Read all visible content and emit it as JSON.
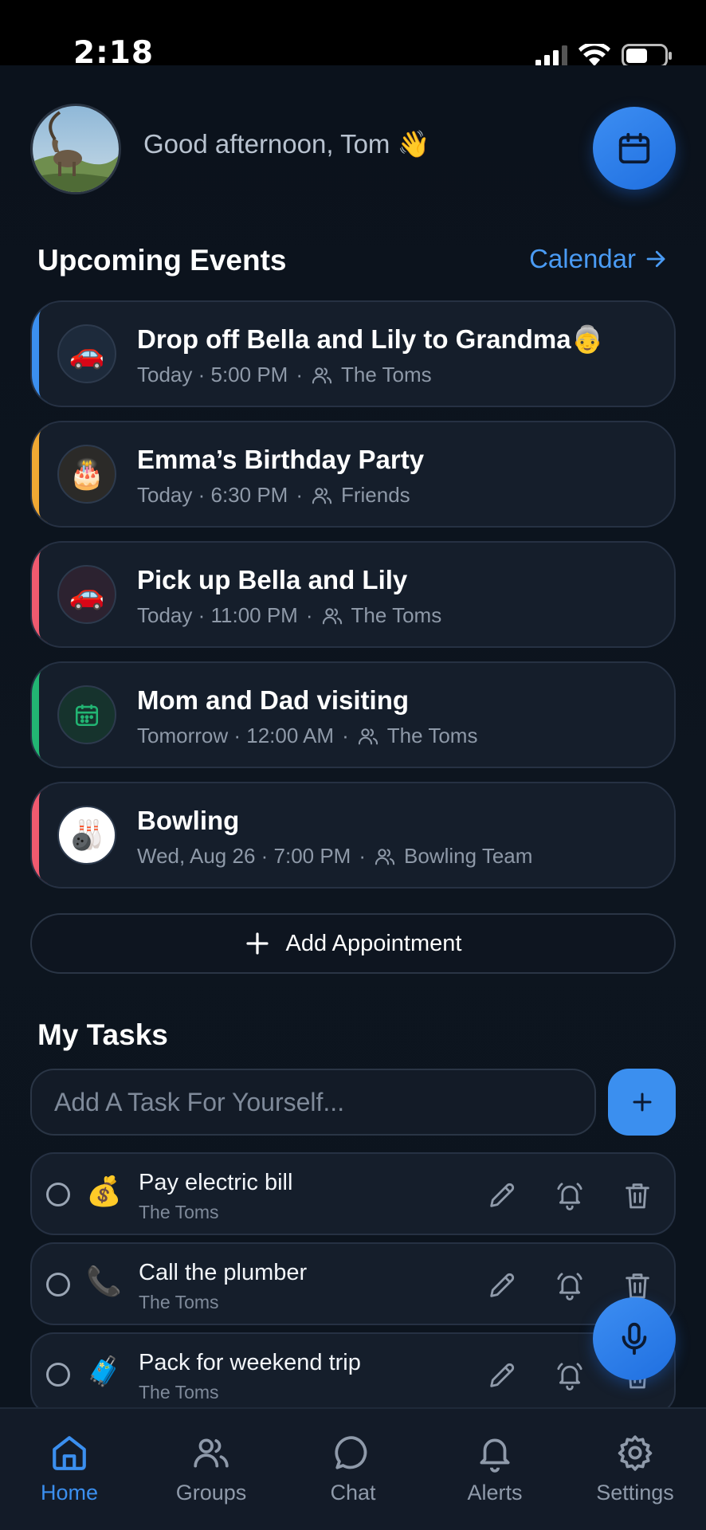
{
  "status_bar": {
    "time": "2:18"
  },
  "header": {
    "greeting": "Good afternoon, Tom 👋",
    "avatar_alt": "ibex"
  },
  "events": {
    "title": "Upcoming Events",
    "calendar_link": "Calendar",
    "items": [
      {
        "emoji": "🚗",
        "title": "Drop off Bella and Lily to Grandma👵",
        "when": "Today · 5:00 PM",
        "group": "The Toms",
        "accent": "#3b8fef",
        "icon_bg": "#1d2a3b"
      },
      {
        "emoji": "🎂",
        "title": "Emma’s Birthday Party",
        "when": "Today · 6:30 PM",
        "group": "Friends",
        "accent": "#f0a833",
        "icon_bg": "#2b2a28"
      },
      {
        "emoji": "🚗",
        "title": "Pick up Bella and Lily",
        "when": "Today · 11:00 PM",
        "group": "The Toms",
        "accent": "#ef5a6f",
        "icon_bg": "#2c2230"
      },
      {
        "emoji": "",
        "title": "Mom and Dad visiting",
        "when": "Tomorrow · 12:00 AM",
        "group": "The Toms",
        "accent": "#22b573",
        "icon_bg": "#16332d"
      },
      {
        "emoji": "🎳",
        "title": "Bowling",
        "when": "Wed, Aug 26 · 7:00 PM",
        "group": "Bowling Team",
        "accent": "#ef5a6f",
        "icon_bg": "#ffffff"
      }
    ],
    "add_label": "Add Appointment"
  },
  "tasks": {
    "title": "My Tasks",
    "input_placeholder": "Add A Task For Yourself...",
    "items": [
      {
        "emoji": "💰",
        "title": "Pay electric bill",
        "group": "The Toms"
      },
      {
        "emoji": "📞",
        "title": "Call the plumber",
        "group": "The Toms"
      },
      {
        "emoji": "🧳",
        "title": "Pack for weekend trip",
        "group": "The Toms"
      }
    ]
  },
  "tabs": [
    {
      "label": "Home",
      "icon": "home-icon",
      "active": true
    },
    {
      "label": "Groups",
      "icon": "users-icon",
      "active": false
    },
    {
      "label": "Chat",
      "icon": "chat-bubble-icon",
      "active": false
    },
    {
      "label": "Alerts",
      "icon": "bell-icon",
      "active": false
    },
    {
      "label": "Settings",
      "icon": "gear-icon",
      "active": false
    }
  ],
  "colors": {
    "accent_blue": "#3b8fef",
    "background": "#0f1722",
    "card": "#151e2b"
  }
}
